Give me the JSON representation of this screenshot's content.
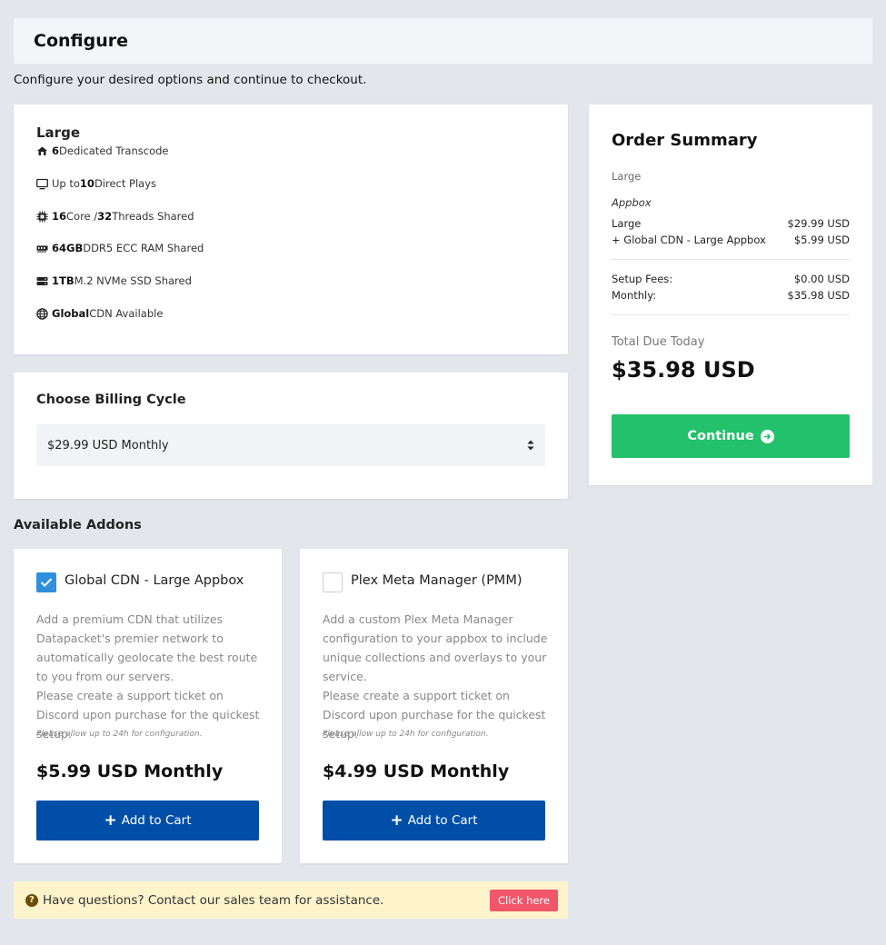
{
  "header": {
    "title": "Configure"
  },
  "subtitle": "Configure your desired options and continue to checkout.",
  "product": {
    "name": "Large",
    "features": [
      {
        "icon": "server-house-icon",
        "bold": "6",
        "text": " Dedicated Transcode"
      },
      {
        "icon": "monitor-icon",
        "pre": "Up to ",
        "bold": "10",
        "text": " Direct Plays"
      },
      {
        "icon": "cpu-icon",
        "bold": "16",
        "text": " Core / ",
        "bold2": "32",
        "text2": " Threads Shared"
      },
      {
        "icon": "memory-icon",
        "bold": "64GB",
        "text": " DDR5 ECC RAM Shared"
      },
      {
        "icon": "hard-drive-icon",
        "bold": "1TB",
        "text": " M.2 NVMe SSD Shared"
      },
      {
        "icon": "globe-icon",
        "bold": "Global",
        "text": " CDN Available"
      }
    ]
  },
  "billing": {
    "title": "Choose Billing Cycle",
    "selected": "$29.99 USD Monthly"
  },
  "addons_heading": "Available Addons",
  "addons": [
    {
      "title": "Global CDN - Large Appbox",
      "checked": true,
      "desc1": "Add a premium CDN that utilizes Datapacket's premier network to automatically geolocate the best route to you from our servers.",
      "desc2": "Please create a support ticket on Discord upon purchase for the quickest setup.",
      "note": "Please allow up to 24h for configuration.",
      "price": "$5.99 USD Monthly",
      "button": "Add to Cart"
    },
    {
      "title": "Plex Meta Manager (PMM)",
      "checked": false,
      "desc1": "Add a custom Plex Meta Manager configuration to your appbox to include unique collections and overlays to your service.",
      "desc2": "Please create a support ticket on Discord upon purchase for the quickest setup.",
      "note": "Please allow up to 24h for configuration.",
      "price": "$4.99 USD Monthly",
      "button": "Add to Cart"
    }
  ],
  "summary": {
    "title": "Order Summary",
    "product": "Large",
    "group": "Appbox",
    "lines": [
      {
        "label": "Large",
        "value": "$29.99 USD"
      },
      {
        "label": "+ Global CDN - Large Appbox",
        "value": "$5.99 USD"
      }
    ],
    "fees": [
      {
        "label": "Setup Fees:",
        "value": "$0.00 USD"
      },
      {
        "label": "Monthly:",
        "value": "$35.98 USD"
      }
    ],
    "total_label": "Total Due Today",
    "total_value": "$35.98 USD",
    "continue_label": "Continue"
  },
  "help": {
    "text": "Have questions? Contact our sales team for assistance.",
    "button": "Click here"
  },
  "colors": {
    "primary": "#004ea8",
    "success": "#23c16b",
    "checkbox": "#2f8fdd",
    "help_bg": "#fdf4cc",
    "help_btn": "#f2566a"
  }
}
